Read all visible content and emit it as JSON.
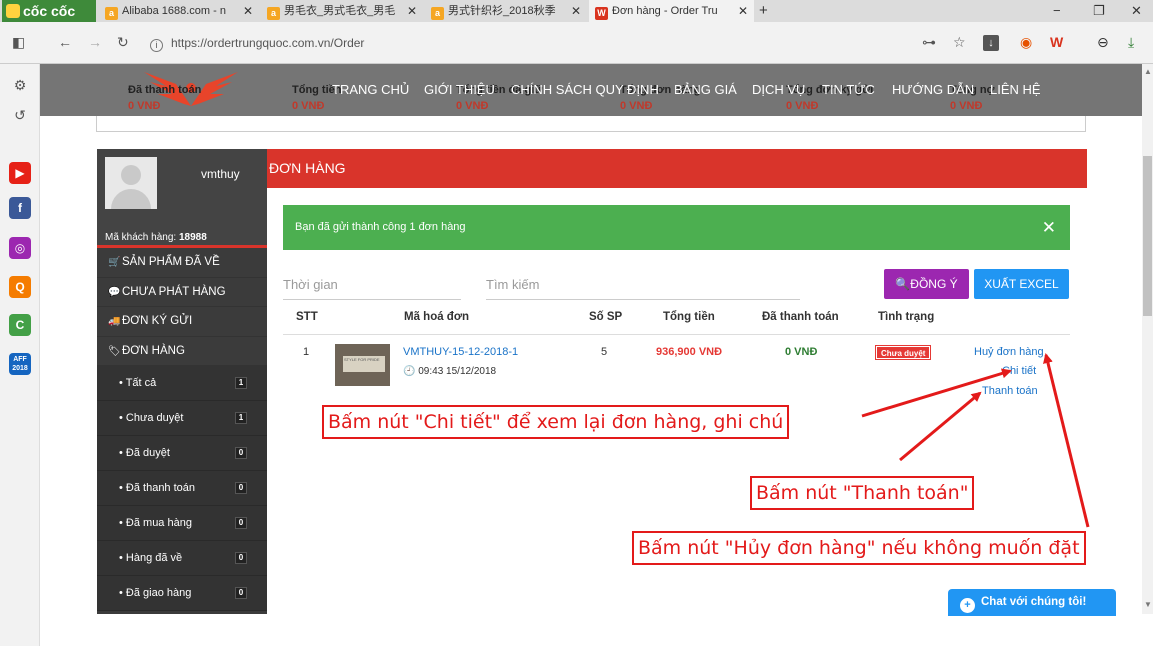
{
  "browser": {
    "brand": "cốc cốc",
    "tabs": [
      {
        "title": "Alibaba 1688.com - n",
        "fav": "orange"
      },
      {
        "title": "男毛衣_男式毛衣_男毛",
        "fav": "orange"
      },
      {
        "title": "男式针织衫_2018秋季",
        "fav": "orange"
      },
      {
        "title": "Đơn hàng - Order Tru",
        "fav": "red"
      }
    ],
    "url": "https://ordertrungquoc.com.vn/Order",
    "icons": {
      "back": "arrow-left-icon",
      "forward": "arrow-right-icon",
      "reload": "reload-icon",
      "info": "info-icon",
      "key": "key-icon",
      "star": "star-icon",
      "download": "download-icon"
    },
    "sidebar_icons": [
      "settings-icon",
      "history-icon",
      "youtube-icon",
      "facebook-icon",
      "music-icon",
      "search-icon",
      "coupon-icon",
      "aff-icon"
    ],
    "aff_label": "AFF 2018"
  },
  "site": {
    "stats": [
      {
        "label": "Đã thanh toán",
        "value": "0 VNĐ"
      },
      {
        "label": "Tổng tiền",
        "value": "0 VNĐ"
      },
      {
        "label": "Tổng tiền đã giữ",
        "value": "0 VNĐ"
      },
      {
        "label": "Tổng đơn hàng",
        "value": "0 VNĐ"
      },
      {
        "label": "Tổng đơn ký gửi",
        "value": "0 VNĐ"
      },
      {
        "label": "Tổng nợ",
        "value": "0 VNĐ"
      }
    ],
    "menu": [
      "TRANG CHỦ",
      "GIỚI THIỆU",
      "CHÍNH SÁCH QUY ĐỊNH",
      "BẢNG GIÁ",
      "DỊCH VỤ",
      "TIN TỨC",
      "HƯỚNG DẪN",
      "LIÊN HỆ"
    ]
  },
  "member": {
    "username": "vmthuy",
    "customer_id_label": "Mã khách hàng:",
    "customer_id": "18988",
    "menu": [
      {
        "label": "SẢN PHẨM ĐÃ VỀ",
        "icon": "cart-icon",
        "glyph": "🛒"
      },
      {
        "label": "CHƯA PHÁT HÀNG",
        "icon": "comment-icon",
        "glyph": "💬"
      },
      {
        "label": "ĐƠN KÝ GỬI",
        "icon": "truck-icon",
        "glyph": "🚚"
      },
      {
        "label": "ĐƠN HÀNG",
        "icon": "tag-icon",
        "glyph": "🏷"
      }
    ],
    "order_filters": [
      {
        "label": "• Tất cả",
        "count": "1"
      },
      {
        "label": "• Chưa duyệt",
        "count": "1"
      },
      {
        "label": "• Đã duyệt",
        "count": "0"
      },
      {
        "label": "• Đã thanh toán",
        "count": "0"
      },
      {
        "label": "• Đã mua hàng",
        "count": "0"
      },
      {
        "label": "• Hàng đã về",
        "count": "0"
      },
      {
        "label": "• Đã giao hàng",
        "count": "0"
      }
    ]
  },
  "main": {
    "heading": "ĐƠN HÀNG",
    "alert": "Bạn đã gửi thành công 1 đơn hàng",
    "filter_time_placeholder": "Thời gian",
    "filter_search_placeholder": "Tìm kiếm",
    "agree_label": "ĐỒNG Ý",
    "export_label": "XUẤT EXCEL",
    "columns": [
      "STT",
      "Mã hoá đơn",
      "Số SP",
      "Tổng tiền",
      "Đã thanh toán",
      "Tình trạng"
    ],
    "row": {
      "stt": "1",
      "code": "VMTHUY-15-12-2018-1",
      "datetime": "09:43 15/12/2018",
      "qty": "5",
      "total": "936,900 VNĐ",
      "paid": "0 VNĐ",
      "status": "Chưa duyệt",
      "actions": {
        "cancel": "Huỷ đơn hàng",
        "detail": "Chi tiết",
        "pay": "Thanh toán"
      }
    }
  },
  "annotations": {
    "detail": "Bấm nút \"Chi tiết\" để xem lại đơn hàng, ghi chú",
    "pay": "Bấm nút \"Thanh toán\"",
    "cancel": "Bấm nút \"Hủy đơn hàng\" nếu không muốn đặt"
  },
  "chat_label": "Chat với chúng tôi!",
  "colors": {
    "header_red": "#d9342b",
    "success_green": "#4caf50",
    "agree_purple": "#9c27b0",
    "excel_blue": "#2196f3",
    "annotation_red": "#e31a1a"
  }
}
